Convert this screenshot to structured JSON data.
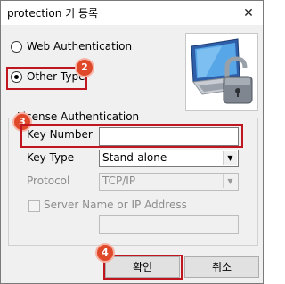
{
  "window": {
    "title": "protection 키 등록",
    "close_glyph": "✕"
  },
  "auth_mode": {
    "options": [
      {
        "label": "Web Authentication",
        "checked": false
      },
      {
        "label": "Other Type",
        "checked": true
      }
    ]
  },
  "logo": {
    "icon": "computer-with-padlock-icon"
  },
  "license": {
    "group_title": "License Authentication",
    "key_number_label": "Key Number",
    "key_number_value": "",
    "key_type_label": "Key Type",
    "key_type_value": "Stand-alone",
    "protocol_label": "Protocol",
    "protocol_value": "TCP/IP",
    "server_checkbox_label": "Server Name or IP Address",
    "server_checked": false,
    "server_value": ""
  },
  "buttons": {
    "ok": "확인",
    "cancel": "취소"
  },
  "annotations": {
    "badge_2": "2",
    "badge_3": "3",
    "badge_4": "4",
    "highlight_color": "#c0161f",
    "badge_color": "#e0482a"
  }
}
